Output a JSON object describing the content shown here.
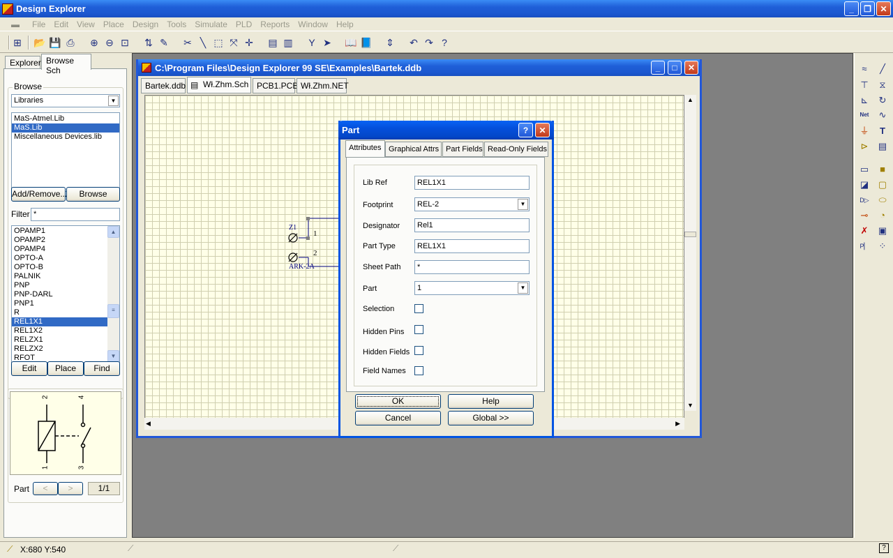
{
  "app": {
    "title": "Design Explorer"
  },
  "menu": [
    "File",
    "Edit",
    "View",
    "Place",
    "Design",
    "Tools",
    "Simulate",
    "PLD",
    "Reports",
    "Window",
    "Help"
  ],
  "left_panel": {
    "tabs": [
      "Explorer",
      "Browse Sch"
    ],
    "browse_label": "Browse",
    "browse_select": "Libraries",
    "libraries": [
      "MaS-Atmel.Lib",
      "MaS.Lib",
      "Miscellaneous Devices.lib"
    ],
    "add_remove_label": "Add/Remove...",
    "browse_button_label": "Browse",
    "filter_label": "Filter",
    "filter_value": "*",
    "components": [
      "OPAMP1",
      "OPAMP2",
      "OPAMP4",
      "OPTO-A",
      "OPTO-B",
      "PALNIK",
      "PNP",
      "PNP-DARL",
      "PNP1",
      "R",
      "REL1X1",
      "REL1X2",
      "RELZX1",
      "RELZX2",
      "RFOT"
    ],
    "edit_label": "Edit",
    "place_label": "Place",
    "find_label": "Find",
    "preview_pins": [
      "2",
      "4",
      "1",
      "3"
    ],
    "part_label": "Part",
    "part_prev": "<",
    "part_next": ">",
    "part_counter": "1/1"
  },
  "document": {
    "title": "C:\\Program Files\\Design Explorer 99 SE\\Examples\\Bartek.ddb",
    "tabs": [
      "Bartek.ddb",
      "Wł.Zhm.Sch",
      "PCB1.PCB",
      "Wł.Zhm.NET"
    ],
    "schematic": {
      "designator": "Z1",
      "pin1": "1",
      "pin2": "2",
      "part_label": "ARK-2A"
    }
  },
  "dialog": {
    "title": "Part",
    "tabs": [
      "Attributes",
      "Graphical Attrs",
      "Part Fields",
      "Read-Only Fields"
    ],
    "fields": {
      "lib_ref_label": "Lib Ref",
      "lib_ref": "REL1X1",
      "footprint_label": "Footprint",
      "footprint": "REL-2",
      "designator_label": "Designator",
      "designator": "Rel1",
      "part_type_label": "Part Type",
      "part_type": "REL1X1",
      "sheet_path_label": "Sheet Path",
      "sheet_path": "*",
      "part_label": "Part",
      "part": "1",
      "selection_label": "Selection",
      "hidden_pins_label": "Hidden Pins",
      "hidden_fields_label": "Hidden Fields",
      "field_names_label": "Field Names"
    },
    "ok_label": "OK",
    "help_label": "Help",
    "cancel_label": "Cancel",
    "global_label": "Global >>"
  },
  "status": {
    "coords": "X:680 Y:540"
  },
  "colors": {
    "titlebar": "#1f5fd8",
    "selection": "#316ac5",
    "sheet": "#ffffe8",
    "workspace": "#808080"
  }
}
